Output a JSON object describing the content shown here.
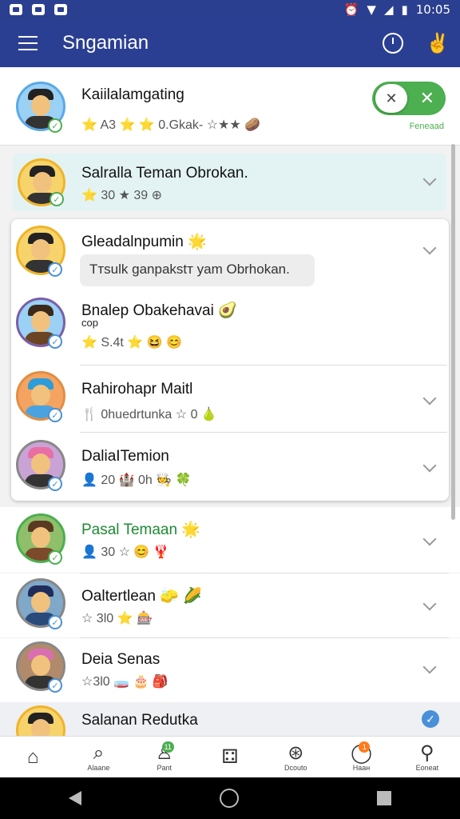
{
  "status_bar": {
    "time": "10:05"
  },
  "app_bar": {
    "title": "Sngamian"
  },
  "profile": {
    "name": "Kaiilalamgating",
    "meta": "⭐ A3 ⭐ ⭐ 0.Gkak- ☆★★ 🥔",
    "toggle_caption": "Feneaad"
  },
  "highlighted": {
    "name": "Salralla Teman Obrokan.",
    "meta": "⭐ 30 ★ 39 ⊕"
  },
  "card_items": [
    {
      "name": "Gleadalnpumin 🌟",
      "bubble": "Tтsulk ganpakstт yam Obrhokan."
    },
    {
      "name": "Bnalep Obakehavai 🥑",
      "sub": "cop",
      "meta": "⭐ Ѕ.4t ⭐ 😆 😊"
    },
    {
      "name": "Rahirohapr Maitl",
      "meta": "🍴 0huedrtunka ☆ 0 🍐"
    },
    {
      "name": "DaliaITemion",
      "meta": "👤 20 🏰 0h 🧑‍🍳 🍀"
    }
  ],
  "list_items": [
    {
      "name": "Pasal Temaan 🌟",
      "meta": "👤 30 ☆ 😊 🦞"
    },
    {
      "name": "Oaltertlean 🧽 🌽",
      "meta": "☆ 3l0 ⭐ 🎰"
    },
    {
      "name": "Deia Senas",
      "meta": "☆3l0 🧫 🎂 🎒"
    },
    {
      "name": "Salanan Redutka"
    }
  ],
  "bottom_nav": [
    {
      "icon": "⌂",
      "label": ""
    },
    {
      "icon": "⌕",
      "label": "Alaane"
    },
    {
      "icon": "♙",
      "label": "Pant",
      "badge": "11"
    },
    {
      "icon": "⚃",
      "label": ""
    },
    {
      "icon": "⊛",
      "label": "Dcouto"
    },
    {
      "icon": "◯",
      "label": "Наан",
      "badge": "1"
    },
    {
      "icon": "⚲",
      "label": "Eoneat"
    }
  ]
}
